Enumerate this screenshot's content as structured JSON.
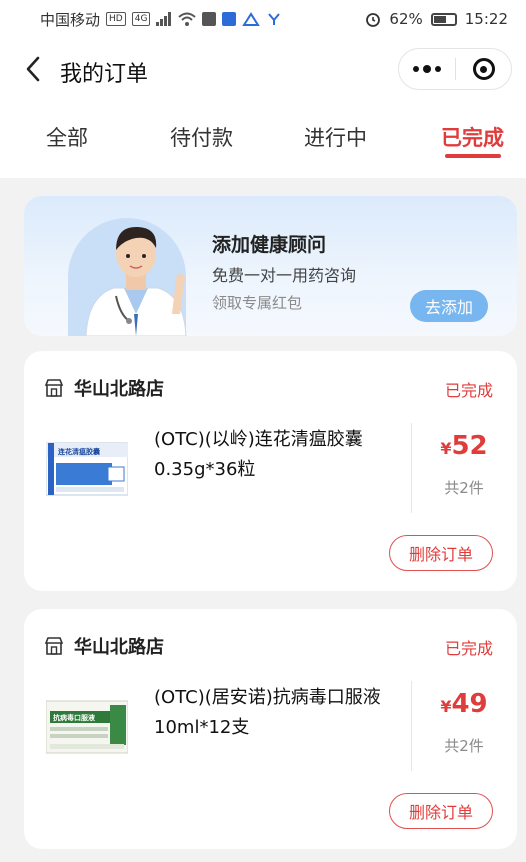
{
  "status_bar": {
    "carrier": "中国移动",
    "hd_badge": "HD",
    "network_badge": "4G",
    "battery_percent": "62%",
    "battery_level": 0.62,
    "time": "15:22"
  },
  "navbar": {
    "back_icon": "chevron-left-icon",
    "title": "我的订单"
  },
  "tabs": [
    {
      "label": "全部",
      "active": false
    },
    {
      "label": "待付款",
      "active": false
    },
    {
      "label": "进行中",
      "active": false
    },
    {
      "label": "已完成",
      "active": true
    }
  ],
  "banner": {
    "title": "添加健康顾问",
    "subtitle": "免费一对一用药咨询",
    "note": "领取专属红包",
    "button_label": "去添加"
  },
  "orders": [
    {
      "store": "华山北路店",
      "status": "已完成",
      "product_name": "(OTC)(以岭)连花清瘟胶囊0.35g*36粒",
      "package_text": "连花清瘟胶囊",
      "currency": "¥",
      "price": "52",
      "quantity": "共2件",
      "delete_label": "删除订单"
    },
    {
      "store": "华山北路店",
      "status": "已完成",
      "product_name": "(OTC)(居安诺)抗病毒口服液 10ml*12支",
      "package_text": "抗病毒口服液",
      "currency": "¥",
      "price": "49",
      "quantity": "共2件",
      "delete_label": "删除订单"
    }
  ],
  "colors": {
    "accent": "#e03c3c",
    "banner_button": "#77b6ef",
    "background": "#f2f2f2"
  }
}
